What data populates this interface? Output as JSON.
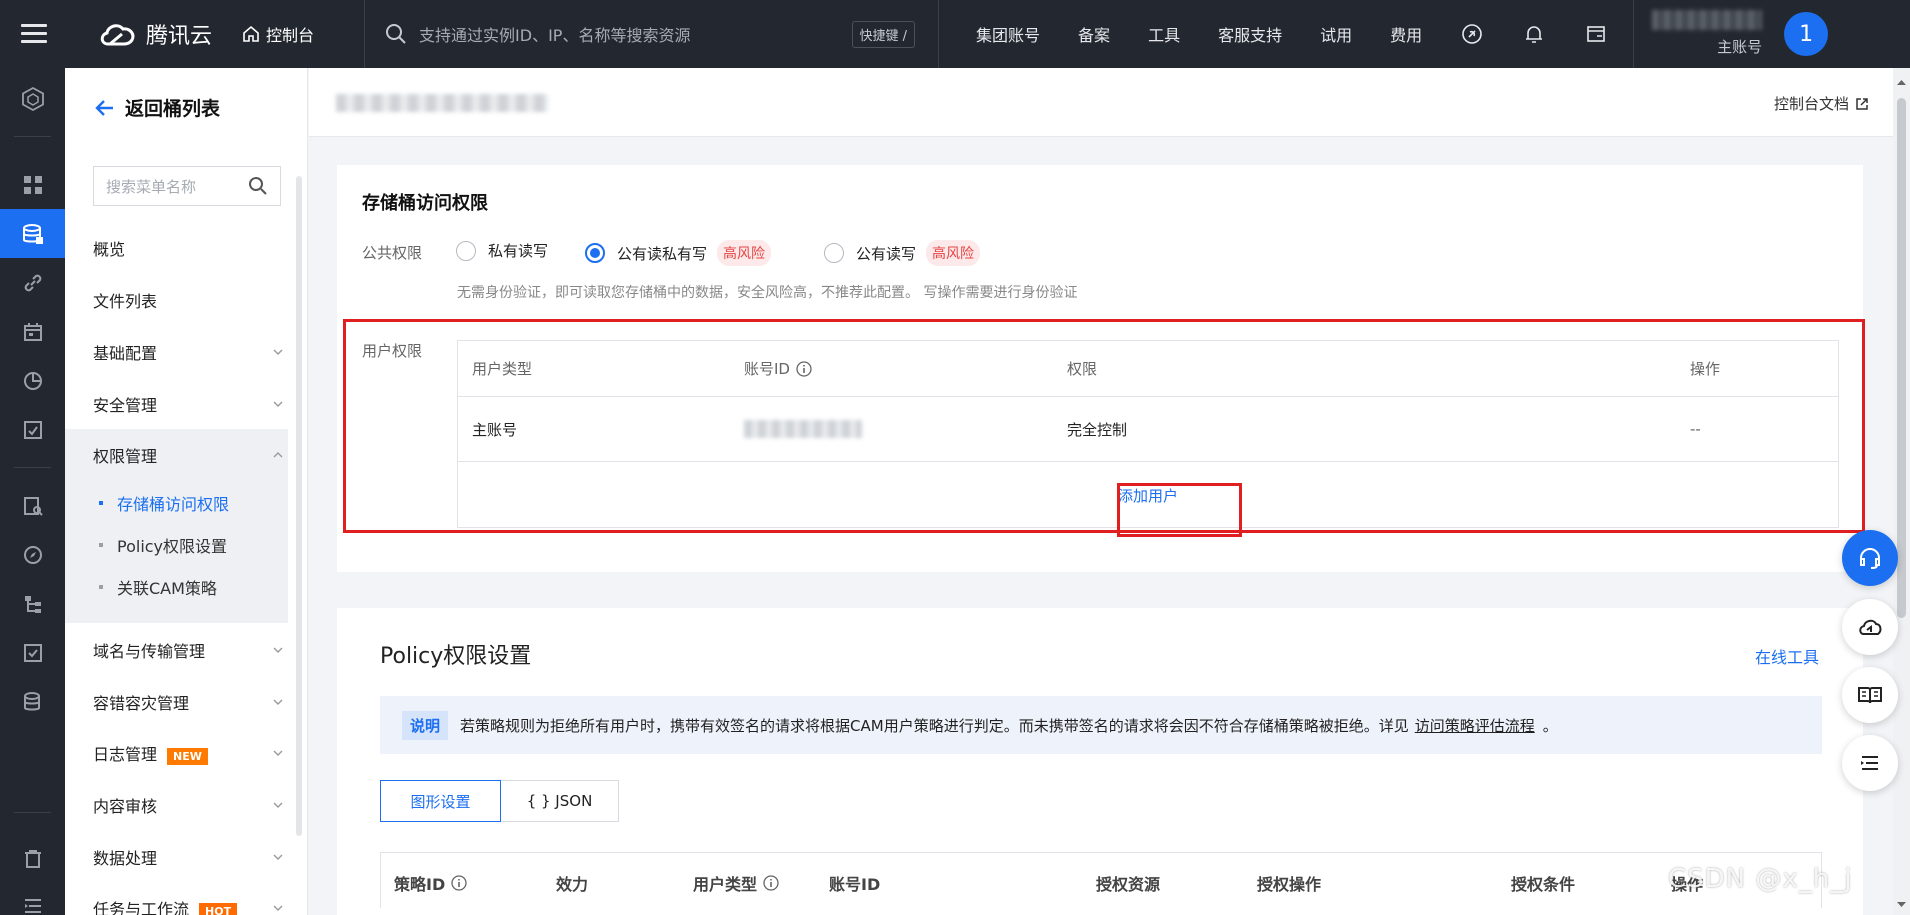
{
  "topbar": {
    "brand": "腾讯云",
    "console": "控制台",
    "search_placeholder": "支持通过实例ID、IP、名称等搜索资源",
    "shortcut": "快捷键 /",
    "nav": [
      "集团账号",
      "备案",
      "工具",
      "客服支持",
      "试用",
      "费用"
    ],
    "user_role": "主账号",
    "avatar_text": "1"
  },
  "sidebar": {
    "back_label": "返回桶列表",
    "search_placeholder": "搜索菜单名称",
    "menu": {
      "overview": "概览",
      "file_list": "文件列表",
      "basic_config": "基础配置",
      "security": "安全管理",
      "permissions": "权限管理",
      "domain": "域名与传输管理",
      "dr": "容错容灾管理",
      "logs": "日志管理",
      "audit": "内容审核",
      "data_processing": "数据处理",
      "tasks": "任务与工作流"
    },
    "sub_items": [
      "存储桶访问权限",
      "Policy权限设置",
      "关联CAM策略"
    ],
    "badge_new": "NEW",
    "badge_hot": "HOT"
  },
  "content": {
    "docs_link": "控制台文档",
    "access": {
      "title": "存储桶访问权限",
      "public_label": "公共权限",
      "options": [
        "私有读写",
        "公有读私有写",
        "公有读写"
      ],
      "selected_option": "公有读私有写",
      "risk_label": "高风险",
      "hint": "无需身份验证，即可读取您存储桶中的数据，安全风险高，不推荐此配置。 写操作需要进行身份验证",
      "user_perm_label": "用户权限",
      "table_headers": [
        "用户类型",
        "账号ID",
        "权限",
        "操作"
      ],
      "row": {
        "user_type": "主账号",
        "permission": "完全控制",
        "action": "--"
      },
      "add_user": "添加用户"
    },
    "policy": {
      "title": "Policy权限设置",
      "online_tool": "在线工具",
      "notice_tag": "说明",
      "notice_text": "若策略规则为拒绝所有用户时，携带有效签名的请求将根据CAM用户策略进行判定。而未携带签名的请求将会因不符合存储桶策略被拒绝。详见",
      "notice_link": "访问策略评估流程",
      "notice_end": "。",
      "tabs": [
        "图形设置",
        "{ } JSON"
      ],
      "headers": [
        "策略ID",
        "效力",
        "用户类型",
        "账号ID",
        "授权资源",
        "授权操作",
        "授权条件",
        "操作"
      ]
    }
  },
  "watermark": "CSDN @x_h_j",
  "colors": {
    "primary": "#1c6ff0",
    "topbar": "#232830",
    "danger": "#e54545",
    "highlight_box": "#e02020"
  }
}
